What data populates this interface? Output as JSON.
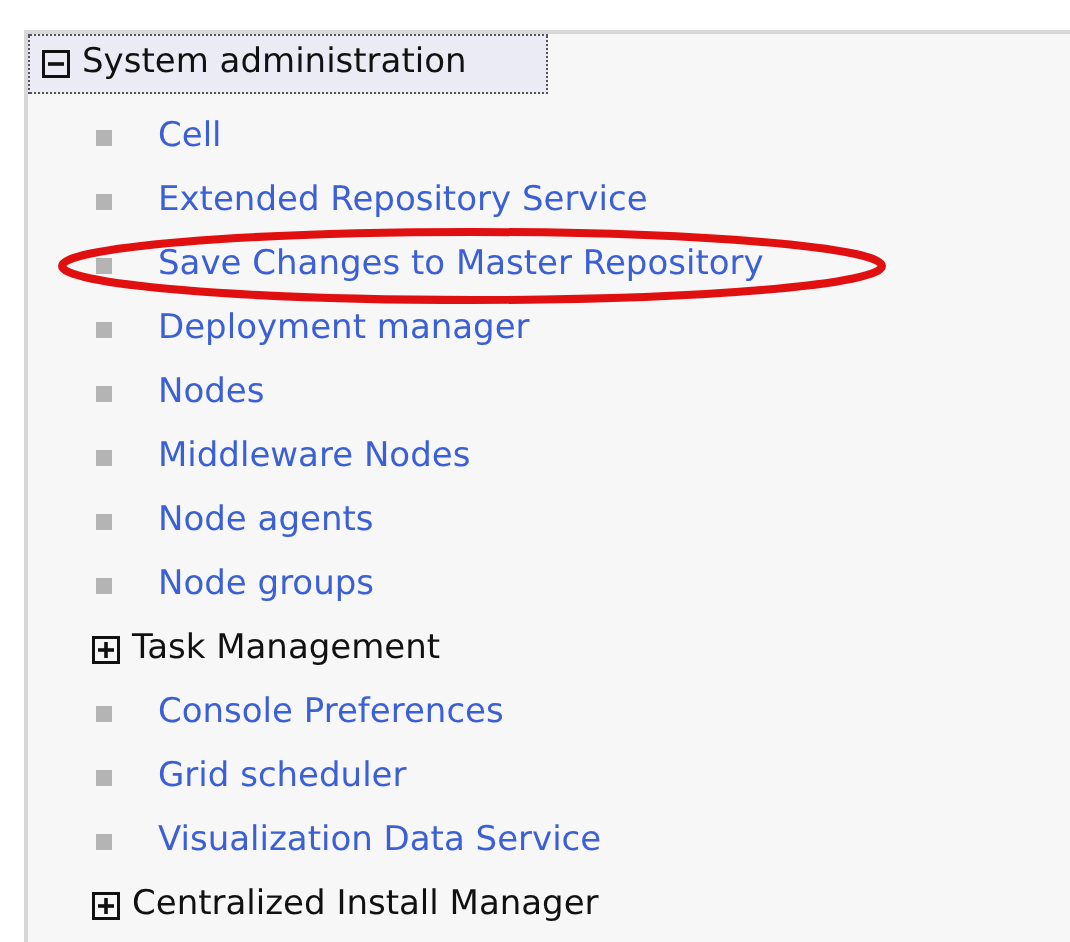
{
  "tree": {
    "label": "System administration",
    "expanded": true,
    "children": [
      {
        "kind": "link",
        "label": "Cell",
        "highlighted": false
      },
      {
        "kind": "link",
        "label": "Extended Repository Service",
        "highlighted": false
      },
      {
        "kind": "link",
        "label": "Save Changes to Master Repository",
        "highlighted": true
      },
      {
        "kind": "link",
        "label": "Deployment manager",
        "highlighted": false
      },
      {
        "kind": "link",
        "label": "Nodes",
        "highlighted": false
      },
      {
        "kind": "link",
        "label": "Middleware Nodes",
        "highlighted": false
      },
      {
        "kind": "link",
        "label": "Node agents",
        "highlighted": false
      },
      {
        "kind": "link",
        "label": "Node groups",
        "highlighted": false
      },
      {
        "kind": "section",
        "label": "Task Management",
        "expanded": false
      },
      {
        "kind": "link",
        "label": "Console Preferences",
        "highlighted": false
      },
      {
        "kind": "link",
        "label": "Grid scheduler",
        "highlighted": false
      },
      {
        "kind": "link",
        "label": "Visualization Data Service",
        "highlighted": false
      },
      {
        "kind": "section",
        "label": "Centralized Install Manager",
        "expanded": false
      }
    ]
  }
}
